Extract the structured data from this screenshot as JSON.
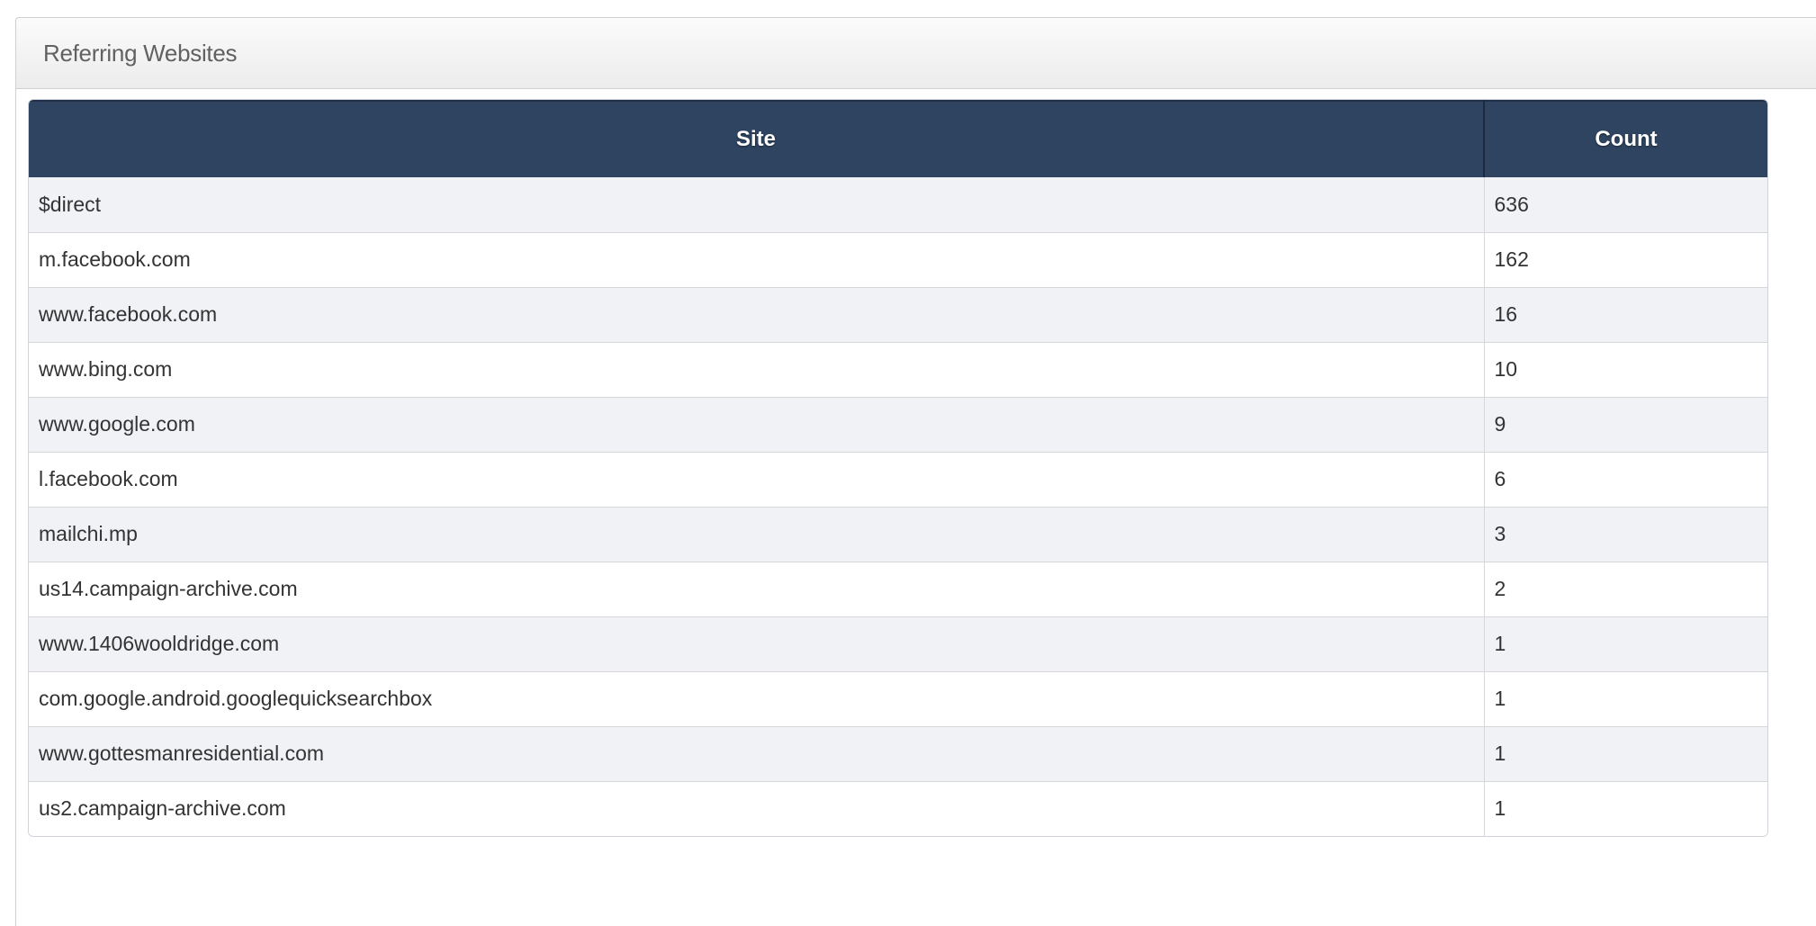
{
  "panel": {
    "title": "Referring Websites"
  },
  "table": {
    "headers": {
      "site": "Site",
      "count": "Count"
    },
    "rows": [
      {
        "site": "$direct",
        "count": "636"
      },
      {
        "site": "m.facebook.com",
        "count": "162"
      },
      {
        "site": "www.facebook.com",
        "count": "16"
      },
      {
        "site": "www.bing.com",
        "count": "10"
      },
      {
        "site": "www.google.com",
        "count": "9"
      },
      {
        "site": "l.facebook.com",
        "count": "6"
      },
      {
        "site": "mailchi.mp",
        "count": "3"
      },
      {
        "site": "us14.campaign-archive.com",
        "count": "2"
      },
      {
        "site": "www.1406wooldridge.com",
        "count": "1"
      },
      {
        "site": "com.google.android.googlequicksearchbox",
        "count": "1"
      },
      {
        "site": "www.gottesmanresidential.com",
        "count": "1"
      },
      {
        "site": "us2.campaign-archive.com",
        "count": "1"
      }
    ]
  },
  "colors": {
    "header_bg": "#2e4461",
    "row_stripe": "#f1f2f6",
    "panel_heading_text": "#616161"
  }
}
